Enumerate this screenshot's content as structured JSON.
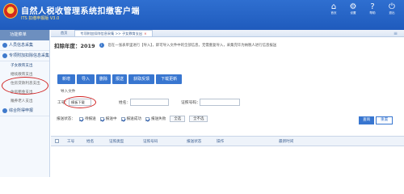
{
  "app": {
    "title": "自然人税收管理系统扣缴客户端",
    "subtitle": "ITS 扣缴申报版 V3.0",
    "top_actions": [
      {
        "icon": "home-icon",
        "glyph": "⌂",
        "label": "首页"
      },
      {
        "icon": "settings-icon",
        "glyph": "⚙",
        "label": "设置"
      },
      {
        "icon": "help-icon",
        "glyph": "?",
        "label": "帮助"
      },
      {
        "icon": "exit-icon",
        "glyph": "⏻",
        "label": "退出"
      }
    ]
  },
  "sidebar": {
    "header": "功能菜单",
    "groups": [
      {
        "label": "人员信息采集",
        "items": []
      },
      {
        "label": "专项附加扣除信息采集",
        "items": [
          "子女教育支出",
          "继续教育支出",
          "住房贷款利息支出",
          "住房租金支出",
          "赡养老人支出"
        ]
      },
      {
        "label": "综合所得申报",
        "items": []
      }
    ],
    "active_item": "子女教育支出"
  },
  "tabs": [
    {
      "label": "首页",
      "active": false,
      "closable": false
    },
    {
      "label": "专项附加扣除信息采集 >> 子女教育支出",
      "active": true,
      "closable": true
    }
  ],
  "period": {
    "label": "扣除年度：2019"
  },
  "notice": "您在一张表单里进行【导入】，即可导入文件中的全部信息，无需重复导入，采集完毕为纳税人进行信息报送",
  "toolbar": [
    "新增",
    "导入",
    "删除",
    "报送",
    "获取反馈",
    "下载更新"
  ],
  "import_menu": [
    "导入文件",
    "模板下载"
  ],
  "filters": {
    "work_id_label": "工号：",
    "name_label": "姓名：",
    "id_label": "证照号码："
  },
  "status": {
    "label": "报送状态：",
    "options": [
      {
        "label": "待报送",
        "checked": true
      },
      {
        "label": "报送中",
        "checked": true
      },
      {
        "label": "报送成功",
        "checked": true
      },
      {
        "label": "报送失败",
        "checked": true
      }
    ],
    "buttons": [
      "全选",
      "全不选"
    ]
  },
  "query": {
    "search": "查询",
    "reset": "重置"
  },
  "table": {
    "columns": [
      "工号",
      "姓名",
      "证照类型",
      "证照号码",
      "报送状态",
      "操作",
      "最新时间"
    ]
  },
  "colors": {
    "header_blue": "#1f5bbd",
    "button_blue": "#3876d0",
    "annotation_red": "#d12424"
  }
}
